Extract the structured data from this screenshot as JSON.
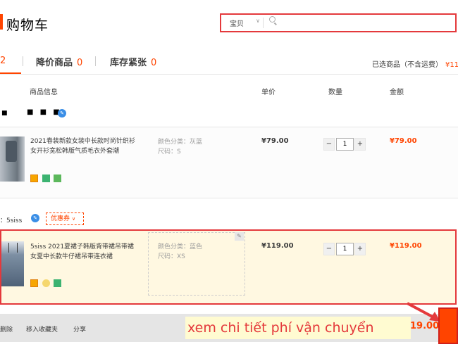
{
  "header": {
    "title": "购物车",
    "search": {
      "scope": "宝贝",
      "placeholder": ""
    }
  },
  "tabs": [
    {
      "label": "",
      "count": "2"
    },
    {
      "label": "降价商品",
      "count": "0"
    },
    {
      "label": "库存紧张",
      "count": "0"
    }
  ],
  "selected_total": {
    "label": "已选商品（不含运费）",
    "amount": "¥11"
  },
  "columns": {
    "info": "商品信息",
    "price": "单价",
    "qty": "数量",
    "sum": "金额"
  },
  "shop1": {
    "name": "■ ■ ■ ■"
  },
  "item1": {
    "title": "2021春装新款女装中长款时尚针织衫女开衫宽松韩版气质毛衣外套潮",
    "color": "颜色分类：灰蓝",
    "size": "尺码：S",
    "price": "¥79.00",
    "qty": "1",
    "sum": "¥79.00"
  },
  "shop2": {
    "name": "：5siss",
    "coupon": "优惠券"
  },
  "item2": {
    "title": "5siss 2021夏裙子韩版背带裙吊带裙女夏中长款牛仔裙吊带连衣裙",
    "color": "颜色分类：蓝色",
    "size": "尺码：XS",
    "price": "¥119.00",
    "qty": "1",
    "sum": "¥119.00"
  },
  "footer": {
    "delete": "删除",
    "favorite": "移入收藏夹",
    "share": "分享",
    "annotation": "xem chi tiết phí vận chuyển",
    "amount": "19.00"
  },
  "colors": {
    "accent": "#ff4400",
    "highlight_border": "#e4393c",
    "selected_row": "#fff8e1"
  }
}
